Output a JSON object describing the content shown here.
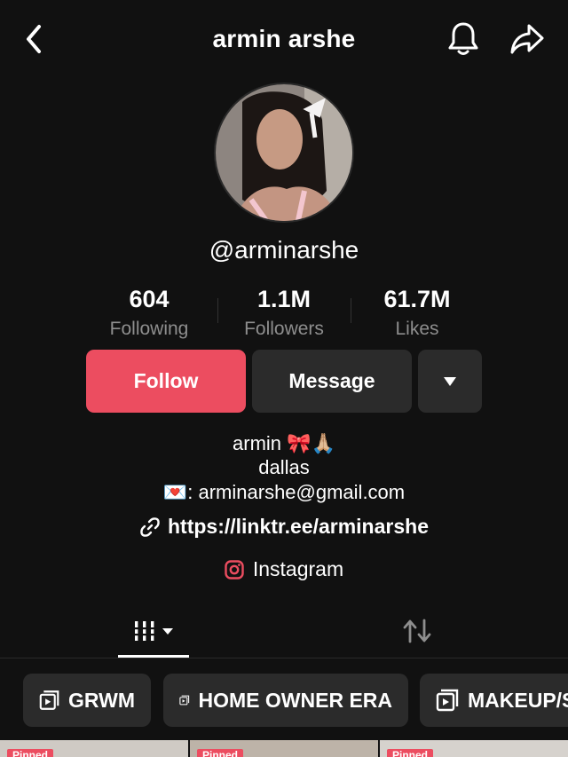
{
  "header": {
    "title": "armin arshe"
  },
  "profile": {
    "username": "@arminarshe"
  },
  "stats": [
    {
      "value": "604",
      "label": "Following"
    },
    {
      "value": "1.1M",
      "label": "Followers"
    },
    {
      "value": "61.7M",
      "label": "Likes"
    }
  ],
  "actions": {
    "follow": "Follow",
    "message": "Message"
  },
  "bio": {
    "line1": "armin 🎀🙏🏼",
    "line2": "dallas",
    "line3_emoji": "💌",
    "line3": ": arminarshe@gmail.com",
    "link": "https://linktr.ee/arminarshe",
    "instagram": "Instagram"
  },
  "playlists": [
    {
      "label": "GRWM"
    },
    {
      "label": "HOME OWNER ERA"
    },
    {
      "label": "MAKEUP/S"
    }
  ],
  "thumbnails": [
    {
      "badge": "Pinned"
    },
    {
      "badge": "Pinned"
    },
    {
      "badge": "Pinned"
    }
  ],
  "colors": {
    "accent": "#ec4d60",
    "background": "#111111",
    "button_dark": "#2b2b2b",
    "muted": "#8e8e8e"
  },
  "icons": [
    "back-icon",
    "bell-icon",
    "share-icon",
    "dropdown-icon",
    "link-icon",
    "instagram-icon",
    "grid-icon",
    "repost-icon",
    "playlist-icon"
  ]
}
